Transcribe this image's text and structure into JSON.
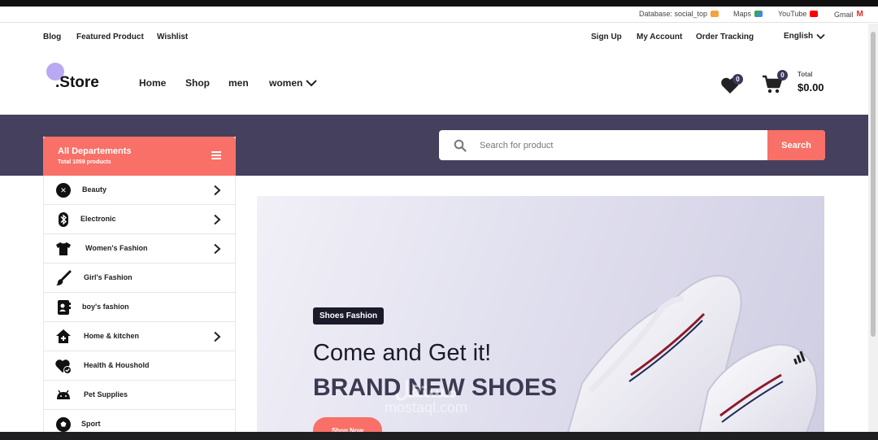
{
  "bookmarks": [
    {
      "label": "Database: social_top",
      "icon": "database-icon",
      "color": "#f3a33a"
    },
    {
      "label": "Maps",
      "icon": "maps-icon",
      "color": "#34a853"
    },
    {
      "label": "YouTube",
      "icon": "youtube-icon",
      "color": "#ff0000"
    },
    {
      "label": "Gmail",
      "icon": "gmail-icon",
      "color": "#d93025"
    }
  ],
  "toplinks": {
    "left": [
      "Blog",
      "Featured Product",
      "Wishlist"
    ],
    "right": [
      "Sign Up",
      "My Account",
      "Order Tracking"
    ],
    "language": "English"
  },
  "header": {
    "logo": ".Store",
    "nav": [
      "Home",
      "Shop",
      "men",
      "women"
    ],
    "wishlist_count": "0",
    "cart_count": "0",
    "total_label": "Total",
    "total_value": "$0.00"
  },
  "search": {
    "placeholder": "Search for product",
    "button": "Search"
  },
  "departments": {
    "title": "All Departements",
    "subtitle": "Total 1059 products",
    "items": [
      {
        "label": "Beauty",
        "icon": "beauty-icon",
        "has_sub": true
      },
      {
        "label": "Electronic",
        "icon": "bluetooth-icon",
        "has_sub": true
      },
      {
        "label": "Women's Fashion",
        "icon": "tshirt-icon",
        "has_sub": true
      },
      {
        "label": "Girl's Fashion",
        "icon": "brush-icon",
        "has_sub": false
      },
      {
        "label": "boy's fashion",
        "icon": "contact-book-icon",
        "has_sub": false
      },
      {
        "label": "Home & kitchen",
        "icon": "home-icon",
        "has_sub": true
      },
      {
        "label": "Health & Houshold",
        "icon": "heart-check-icon",
        "has_sub": false
      },
      {
        "label": "Pet Supplies",
        "icon": "pet-icon",
        "has_sub": false
      },
      {
        "label": "Sport",
        "icon": "ball-icon",
        "has_sub": false
      }
    ]
  },
  "hero": {
    "tag": "Shoes Fashion",
    "headline": "Come and Get it!",
    "subheadline": "BRAND NEW SHOES",
    "button": "Shop Now"
  },
  "watermark": {
    "arabic": "مستقل",
    "latin": "mostaql.com"
  },
  "colors": {
    "accent": "#f87067",
    "band": "#45405d",
    "logo_dot": "#b9a9f2"
  }
}
